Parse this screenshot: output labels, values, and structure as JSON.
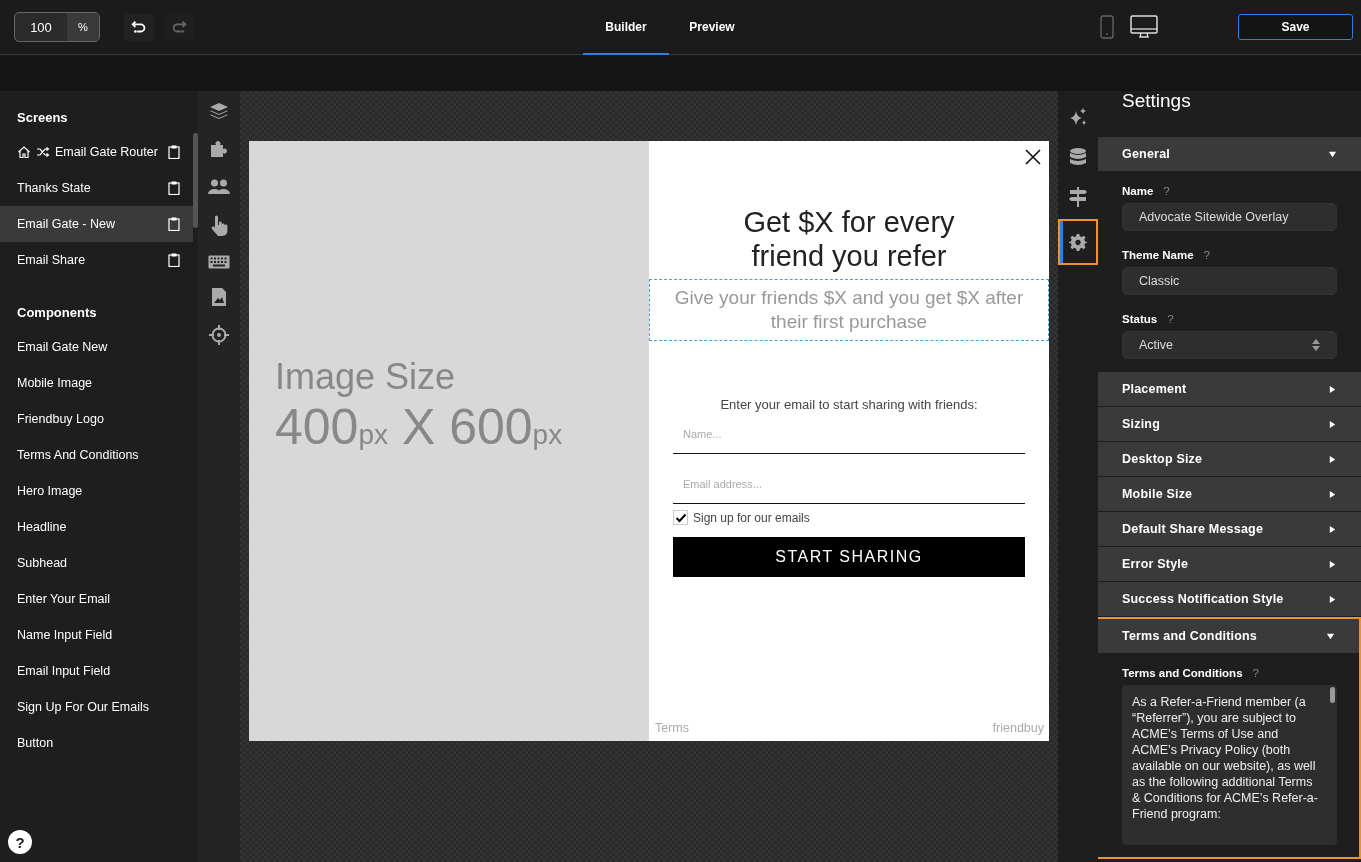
{
  "toolbar": {
    "zoom": {
      "value": "100",
      "unit": "%"
    },
    "undo": {
      "disabled": false
    },
    "redo": {
      "disabled": true
    },
    "tabs": [
      {
        "label": "Builder",
        "selected": true
      },
      {
        "label": "Preview",
        "selected": false
      }
    ],
    "devices": [
      {
        "kind": "phone",
        "selected": false
      },
      {
        "kind": "desktop",
        "selected": true
      }
    ],
    "save": "Save"
  },
  "sidebar": {
    "sections": [
      {
        "title": "Screens",
        "items": [
          {
            "label": "Email Gate Router",
            "kind": "router",
            "selected": false
          },
          {
            "label": "Thanks State",
            "kind": "screen",
            "selected": false
          },
          {
            "label": "Email Gate - New",
            "kind": "screen",
            "selected": true
          },
          {
            "label": "Email Share",
            "kind": "screen",
            "selected": false
          }
        ]
      },
      {
        "title": "Components",
        "items": [
          {
            "label": "Email Gate New",
            "kind": "component",
            "selected": false
          },
          {
            "label": "Mobile Image",
            "kind": "component",
            "selected": false
          },
          {
            "label": "Friendbuy Logo",
            "kind": "component",
            "selected": false
          },
          {
            "label": "Terms And Conditions",
            "kind": "component",
            "selected": false
          },
          {
            "label": "Hero Image",
            "kind": "component",
            "selected": false
          },
          {
            "label": "Headline",
            "kind": "component",
            "selected": false
          },
          {
            "label": "Subhead",
            "kind": "component",
            "selected": false
          },
          {
            "label": "Enter Your Email",
            "kind": "component",
            "selected": false
          },
          {
            "label": "Name Input Field",
            "kind": "component",
            "selected": false
          },
          {
            "label": "Email Input Field",
            "kind": "component",
            "selected": false
          },
          {
            "label": "Sign Up For Our Emails",
            "kind": "component",
            "selected": false
          },
          {
            "label": "Button",
            "kind": "component",
            "selected": false
          }
        ]
      }
    ],
    "help": "?"
  },
  "right_rail": [
    {
      "kind": "sparkle",
      "selected": false,
      "highlighted": false
    },
    {
      "kind": "database",
      "selected": false,
      "highlighted": false
    },
    {
      "kind": "signpost",
      "selected": false,
      "highlighted": false
    },
    {
      "kind": "gear",
      "selected": true,
      "highlighted": true
    }
  ],
  "popup": {
    "image": {
      "title": "Image Size",
      "size": [
        {
          "text": "400",
          "kind": "number"
        },
        {
          "text": "px",
          "kind": "unit"
        },
        {
          "text": " X ",
          "kind": "number"
        },
        {
          "text": "600",
          "kind": "number"
        },
        {
          "text": "px",
          "kind": "unit"
        }
      ]
    },
    "headline": "Get $X for every friend you refer",
    "subhead": "Give your friends $X and you get $X after their first purchase",
    "prompt": "Enter your email to start sharing with friends:",
    "fields": [
      {
        "placeholder": "Name..."
      },
      {
        "placeholder": "Email address..."
      }
    ],
    "checkbox": {
      "label": "Sign up for our emails",
      "checked": true
    },
    "button": "START SHARING",
    "footer": {
      "terms": "Terms",
      "brand": "friendbuy"
    }
  },
  "settings": {
    "title": "Settings",
    "sections": [
      {
        "title": "General",
        "expanded": true,
        "highlighted": false,
        "fields": [
          {
            "label": "Name",
            "help": "?",
            "kind": "text",
            "value": "Advocate Sitewide Overlay"
          },
          {
            "label": "Theme Name",
            "help": "?",
            "kind": "text",
            "value": "Classic"
          },
          {
            "label": "Status",
            "help": "?",
            "kind": "select",
            "value": "Active"
          }
        ]
      },
      {
        "title": "Placement",
        "expanded": false,
        "highlighted": false
      },
      {
        "title": "Sizing",
        "expanded": false,
        "highlighted": false
      },
      {
        "title": "Desktop Size",
        "expanded": false,
        "highlighted": false
      },
      {
        "title": "Mobile Size",
        "expanded": false,
        "highlighted": false
      },
      {
        "title": "Default Share Message",
        "expanded": false,
        "highlighted": false
      },
      {
        "title": "Error Style",
        "expanded": false,
        "highlighted": false
      },
      {
        "title": "Success Notification Style",
        "expanded": false,
        "highlighted": false
      },
      {
        "title": "Terms and Conditions",
        "expanded": true,
        "highlighted": true,
        "fields": [
          {
            "label": "Terms and Conditions",
            "help": "?",
            "kind": "textarea",
            "value": "As a Refer-a-Friend member (a “Referrer”), you are subject to ACME’s Terms of Use and ACME’s Privacy Policy (both available on our website), as well as the following additional Terms & Conditions for ACME’s Refer-a-Friend program:"
          }
        ]
      }
    ]
  }
}
